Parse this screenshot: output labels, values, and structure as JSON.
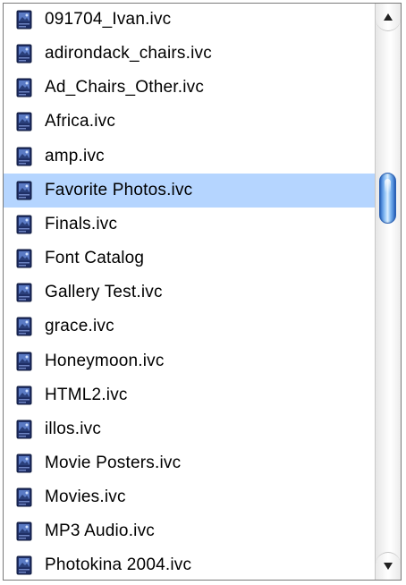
{
  "file_list": {
    "items": [
      {
        "label": "091704_Ivan.ivc",
        "icon": "iview-catalog-icon",
        "selected": false
      },
      {
        "label": "adirondack_chairs.ivc",
        "icon": "iview-catalog-icon",
        "selected": false
      },
      {
        "label": "Ad_Chairs_Other.ivc",
        "icon": "iview-catalog-icon",
        "selected": false
      },
      {
        "label": "Africa.ivc",
        "icon": "iview-catalog-icon",
        "selected": false
      },
      {
        "label": "amp.ivc",
        "icon": "iview-catalog-icon",
        "selected": false
      },
      {
        "label": "Favorite Photos.ivc",
        "icon": "iview-catalog-icon",
        "selected": true
      },
      {
        "label": "Finals.ivc",
        "icon": "iview-catalog-icon",
        "selected": false
      },
      {
        "label": "Font Catalog",
        "icon": "iview-catalog-icon",
        "selected": false
      },
      {
        "label": "Gallery Test.ivc",
        "icon": "iview-catalog-icon",
        "selected": false
      },
      {
        "label": "grace.ivc",
        "icon": "iview-catalog-icon",
        "selected": false
      },
      {
        "label": "Honeymoon.ivc",
        "icon": "iview-catalog-icon",
        "selected": false
      },
      {
        "label": "HTML2.ivc",
        "icon": "iview-catalog-icon",
        "selected": false
      },
      {
        "label": "illos.ivc",
        "icon": "iview-catalog-icon",
        "selected": false
      },
      {
        "label": "Movie Posters.ivc",
        "icon": "iview-catalog-icon",
        "selected": false
      },
      {
        "label": "Movies.ivc",
        "icon": "iview-catalog-icon",
        "selected": false
      },
      {
        "label": "MP3 Audio.ivc",
        "icon": "iview-catalog-icon",
        "selected": false
      },
      {
        "label": "Photokina 2004.ivc",
        "icon": "iview-catalog-icon",
        "selected": false
      }
    ]
  },
  "scrollbar": {
    "up_icon": "scroll-up-arrow-icon",
    "down_icon": "scroll-down-arrow-icon",
    "position_fraction": 0.3
  },
  "colors": {
    "selection": "#b5d5ff",
    "thumb": "#4a8ee0"
  }
}
